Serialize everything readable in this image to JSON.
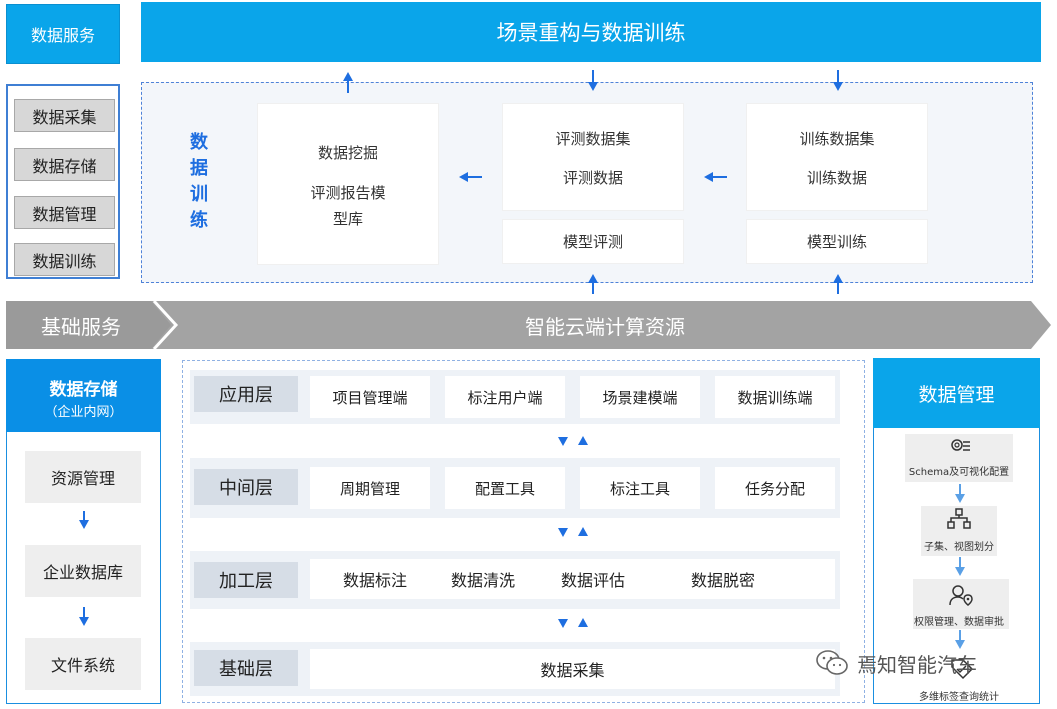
{
  "top_left_label": "数据服务",
  "top_banner_title": "场景重构与数据训练",
  "left_menu": [
    "数据采集",
    "数据存储",
    "数据管理",
    "数据训练"
  ],
  "training": {
    "vertical_label": [
      "数",
      "据",
      "训",
      "练"
    ],
    "mining_title": "数据挖掘",
    "mining_sub": [
      "评测报告模",
      "型库"
    ],
    "eval_set_title": "评测数据集",
    "eval_set_sub": "评测数据",
    "eval_model": "模型评测",
    "train_set_title": "训练数据集",
    "train_set_sub": "训练数据",
    "train_model": "模型训练"
  },
  "band": {
    "base_label": "基础服务",
    "cloud_label": "智能云端计算资源"
  },
  "storage": {
    "title": "数据存储",
    "subtitle": "（企业内网）",
    "items": [
      "资源管理",
      "企业数据库",
      "文件系统"
    ]
  },
  "layers": [
    {
      "label": "应用层",
      "cells": [
        "项目管理端",
        "标注用户端",
        "场景建模端",
        "数据训练端"
      ]
    },
    {
      "label": "中间层",
      "cells": [
        "周期管理",
        "配置工具",
        "标注工具",
        "任务分配"
      ]
    },
    {
      "label": "加工层",
      "cells": [
        "数据标注",
        "数据清洗",
        "数据评估",
        "数据脱密"
      ]
    },
    {
      "label": "基础层",
      "cells": [
        "数据采集"
      ]
    }
  ],
  "management": {
    "title": "数据管理",
    "steps": [
      "Schema及可视化配置",
      "子集、视图划分",
      "权限管理、数据审批",
      "多维标签查询统计"
    ],
    "step_icons": [
      "settings-list-icon",
      "hierarchy-icon",
      "user-lock-icon",
      "tag-check-icon"
    ]
  },
  "watermark": "焉知智能汽车",
  "colors": {
    "primary_blue": "#0aa5ea",
    "arrow_blue": "#1e6ee0",
    "band_grey": "#a8a8a8"
  }
}
